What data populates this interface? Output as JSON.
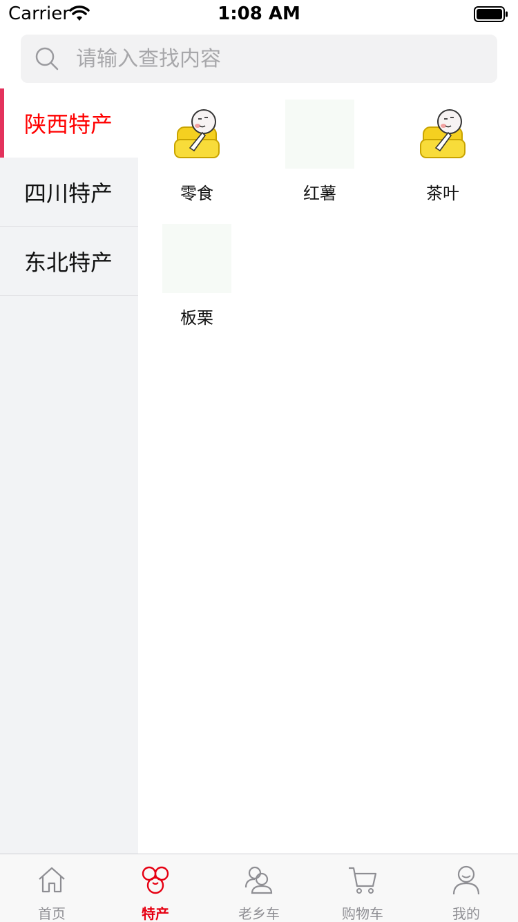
{
  "status_bar": {
    "carrier": "Carrier",
    "time": "1:08 AM"
  },
  "search": {
    "placeholder": "请输入查找内容",
    "value": ""
  },
  "sidebar": {
    "items": [
      {
        "label": "陕西特产",
        "active": true
      },
      {
        "label": "四川特产",
        "active": false
      },
      {
        "label": "东北特产",
        "active": false
      }
    ]
  },
  "products": [
    {
      "label": "零食",
      "image": "sofa-emoji"
    },
    {
      "label": "红薯",
      "image": "placeholder"
    },
    {
      "label": "茶叶",
      "image": "sofa-emoji"
    },
    {
      "label": "板栗",
      "image": "placeholder"
    }
  ],
  "tab_bar": {
    "tabs": [
      {
        "label": "首页",
        "icon": "home-icon",
        "active": false
      },
      {
        "label": "特产",
        "icon": "specialty-icon",
        "active": true
      },
      {
        "label": "老乡车",
        "icon": "users-icon",
        "active": false
      },
      {
        "label": "购物车",
        "icon": "cart-icon",
        "active": false
      },
      {
        "label": "我的",
        "icon": "profile-icon",
        "active": false
      }
    ]
  },
  "colors": {
    "accent": "#e60012",
    "active_side_text": "#ff0000",
    "side_indicator": "#e3325c",
    "sidebar_bg": "#f2f3f5",
    "search_bg": "#f2f2f3"
  }
}
